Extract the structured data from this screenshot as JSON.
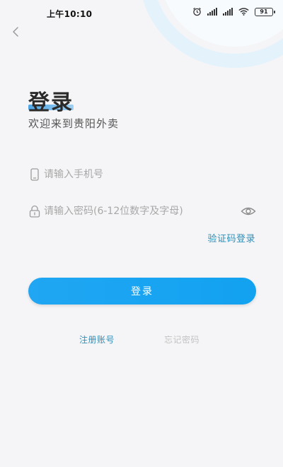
{
  "status_bar": {
    "time": "上午10:10",
    "battery": "91",
    "icons": [
      "alarm-icon",
      "signal-icon",
      "signal-icon",
      "wifi-icon",
      "battery-icon"
    ]
  },
  "nav": {
    "back_icon": "chevron-left-icon"
  },
  "header": {
    "title": "登录",
    "subtitle": "欢迎来到贵阳外卖"
  },
  "form": {
    "phone": {
      "placeholder": "请输入手机号",
      "value": "",
      "icon": "phone-icon"
    },
    "password": {
      "placeholder": "请输入密码(6-12位数字及字母)",
      "value": "",
      "icon": "lock-icon",
      "toggle_icon": "eye-icon"
    },
    "sms_login_label": "验证码登录",
    "login_button_label": "登录"
  },
  "footer": {
    "register_label": "注册账号",
    "forgot_label": "忘记密码"
  },
  "colors": {
    "accent": "#1aa4f2",
    "link": "#2f8fb8",
    "muted": "#c2c2c2",
    "background": "#f5f5f7"
  }
}
